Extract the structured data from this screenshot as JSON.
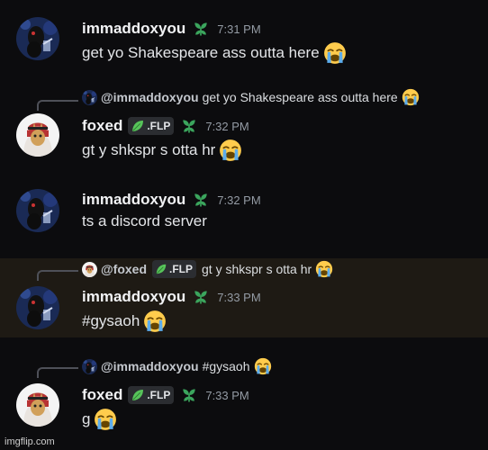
{
  "messages": [
    {
      "user": "immaddoxyou",
      "time": "7:31 PM",
      "text": "get yo Shakespeare ass outta here",
      "emoji": "loudly-crying-face"
    },
    {
      "user": "foxed",
      "tag": ".FLP",
      "time": "7:32 PM",
      "text": "gt y shkspr s otta hr",
      "emoji": "loudly-crying-face",
      "reply": {
        "user": "@immaddoxyou",
        "text": "get yo Shakespeare ass outta here"
      }
    },
    {
      "user": "immaddoxyou",
      "time": "7:32 PM",
      "text": "ts a discord server"
    },
    {
      "user": "immaddoxyou",
      "time": "7:33 PM",
      "text": "#gysaoh",
      "emoji": "loudly-crying-face",
      "reply": {
        "user": "@foxed",
        "tag": ".FLP",
        "text": "gt y shkspr s otta hr"
      }
    },
    {
      "user": "foxed",
      "tag": ".FLP",
      "time": "7:33 PM",
      "text": "g",
      "emoji": "loudly-crying-face",
      "reply": {
        "user": "@immaddoxyou",
        "text": "#gysaoh"
      }
    }
  ],
  "watermark": "imgflip.com",
  "colors": {
    "background": "#0c0c0e",
    "highlight": "#1e1a14",
    "badge_green": "#3ba55d",
    "timestamp": "#949ba4"
  }
}
